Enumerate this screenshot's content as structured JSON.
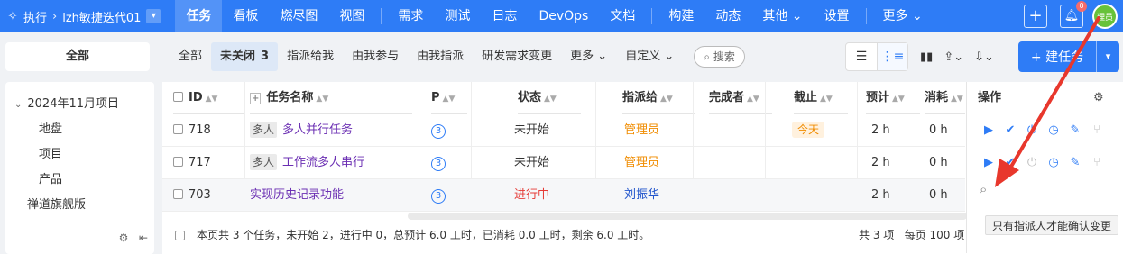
{
  "topbar": {
    "crumb_icon": "sparkle-icon",
    "crumb_exec": "执行",
    "crumb_project": "lzh敏捷迭代01",
    "nav": [
      {
        "label": "任务",
        "active": true
      },
      {
        "label": "看板"
      },
      {
        "label": "燃尽图"
      },
      {
        "label": "视图"
      },
      {
        "label": "需求"
      },
      {
        "label": "测试"
      },
      {
        "label": "日志"
      },
      {
        "label": "DevOps"
      },
      {
        "label": "文档"
      },
      {
        "label": "构建"
      },
      {
        "label": "动态"
      },
      {
        "label": "其他"
      },
      {
        "label": "设置"
      },
      {
        "label": "更多"
      }
    ],
    "notif_count": "0",
    "avatar_text": "理员"
  },
  "subbar": {
    "all_label": "全部",
    "filters": [
      {
        "label": "全部"
      },
      {
        "label": "未关闭",
        "count": "3",
        "active": true
      },
      {
        "label": "指派给我"
      },
      {
        "label": "由我参与"
      },
      {
        "label": "由我指派"
      },
      {
        "label": "研发需求变更"
      },
      {
        "label": "更多"
      },
      {
        "label": "自定义"
      }
    ],
    "search_placeholder": "搜索",
    "create_label": "建任务"
  },
  "sidebar": {
    "tree": [
      {
        "label": "2024年11月项目",
        "level": 0
      },
      {
        "label": "地盘",
        "level": 1
      },
      {
        "label": "项目",
        "level": 1
      },
      {
        "label": "产品",
        "level": 1
      },
      {
        "label": "禅道旗舰版",
        "level": 0
      }
    ]
  },
  "table": {
    "columns": {
      "id": "ID",
      "name": "任务名称",
      "pri": "P",
      "status": "状态",
      "assigned": "指派给",
      "finished_by": "完成者",
      "deadline": "截止",
      "estimate": "预计",
      "consumed": "消耗",
      "actions": "操作"
    },
    "rows": [
      {
        "id": "718",
        "tag": "多人",
        "name": "多人并行任务",
        "pri": "3",
        "status": "未开始",
        "assigned": "管理员",
        "finished_by": "",
        "deadline": "今天",
        "estimate": "2 h",
        "consumed": "0 h"
      },
      {
        "id": "717",
        "tag": "多人",
        "name": "工作流多人串行",
        "pri": "3",
        "status": "未开始",
        "assigned": "管理员",
        "finished_by": "",
        "deadline": "",
        "estimate": "2 h",
        "consumed": "0 h"
      },
      {
        "id": "703",
        "tag": "",
        "name": "实现历史记录功能",
        "pri": "3",
        "status": "进行中",
        "assigned": "刘振华",
        "finished_by": "",
        "deadline": "",
        "estimate": "2 h",
        "consumed": "0 h"
      }
    ],
    "footer_summary": "本页共 3 个任务，未开始 2，进行中 0，总预计 6.0 工时，已消耗 0.0 工时，剩余 6.0 工时。",
    "pager_total": "共 3 项",
    "pager_size": "每页 100 项"
  },
  "tooltip": "只有指派人才能确认变更",
  "colors": {
    "brand": "#2e7cf6",
    "orange": "#f08c00",
    "in_progress": "#e53935",
    "annotation_arrow": "#e8372c"
  }
}
